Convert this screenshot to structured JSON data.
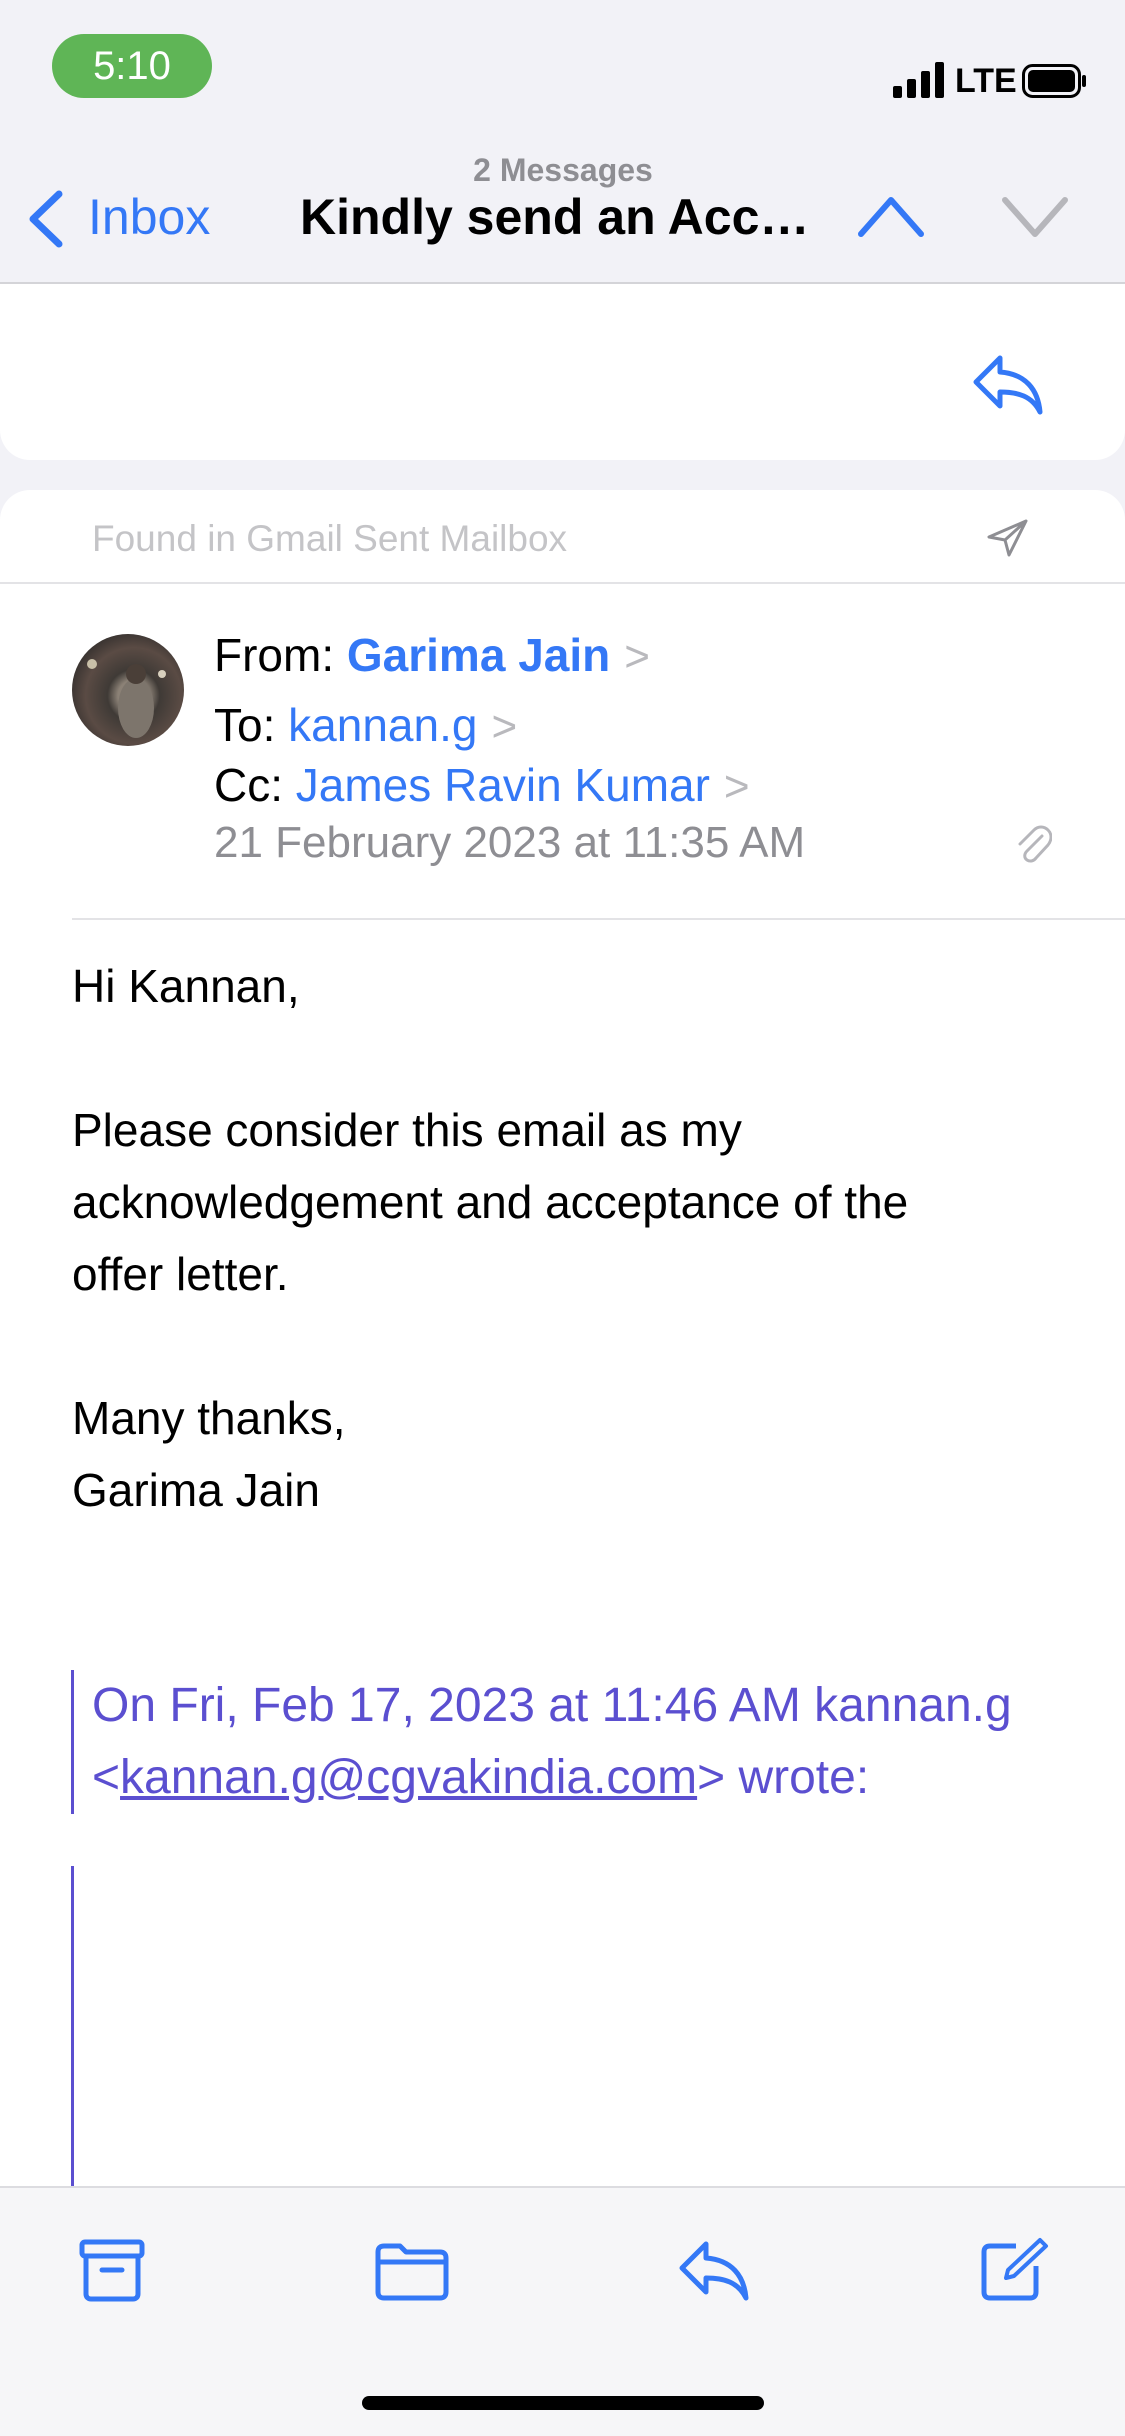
{
  "status_bar": {
    "time": "5:10",
    "network": "LTE"
  },
  "nav": {
    "back_label": "Inbox",
    "message_count": "2 Messages",
    "title": "Kindly send an Acceptance letter"
  },
  "card": {
    "found_text": "Found in Gmail Sent Mailbox",
    "from_label": "From:",
    "from_value": "Garima Jain",
    "to_label": "To:",
    "to_value": "kannan.g",
    "cc_label": "Cc:",
    "cc_value": "James Ravin Kumar",
    "date": "21 February 2023 at 11:35 AM"
  },
  "body": {
    "greeting": "Hi Kannan,",
    "para1_line1": "Please consider this email as my",
    "para1_line2": "acknowledgement and acceptance of the",
    "para1_line3": "offer letter.",
    "signoff1": "Many thanks,",
    "signoff2": "Garima Jain"
  },
  "quote": {
    "line1": "On Fri, Feb 17, 2023 at 11:46 AM kannan.g",
    "open": "<",
    "email": "kannan.g@cgvakindia.com",
    "close": "> wrote:"
  },
  "icons": {
    "accent": "#3478f6",
    "quote_color": "#5b4fd0",
    "toolbar": [
      "archive-icon",
      "folder-icon",
      "reply-icon",
      "compose-icon"
    ]
  }
}
